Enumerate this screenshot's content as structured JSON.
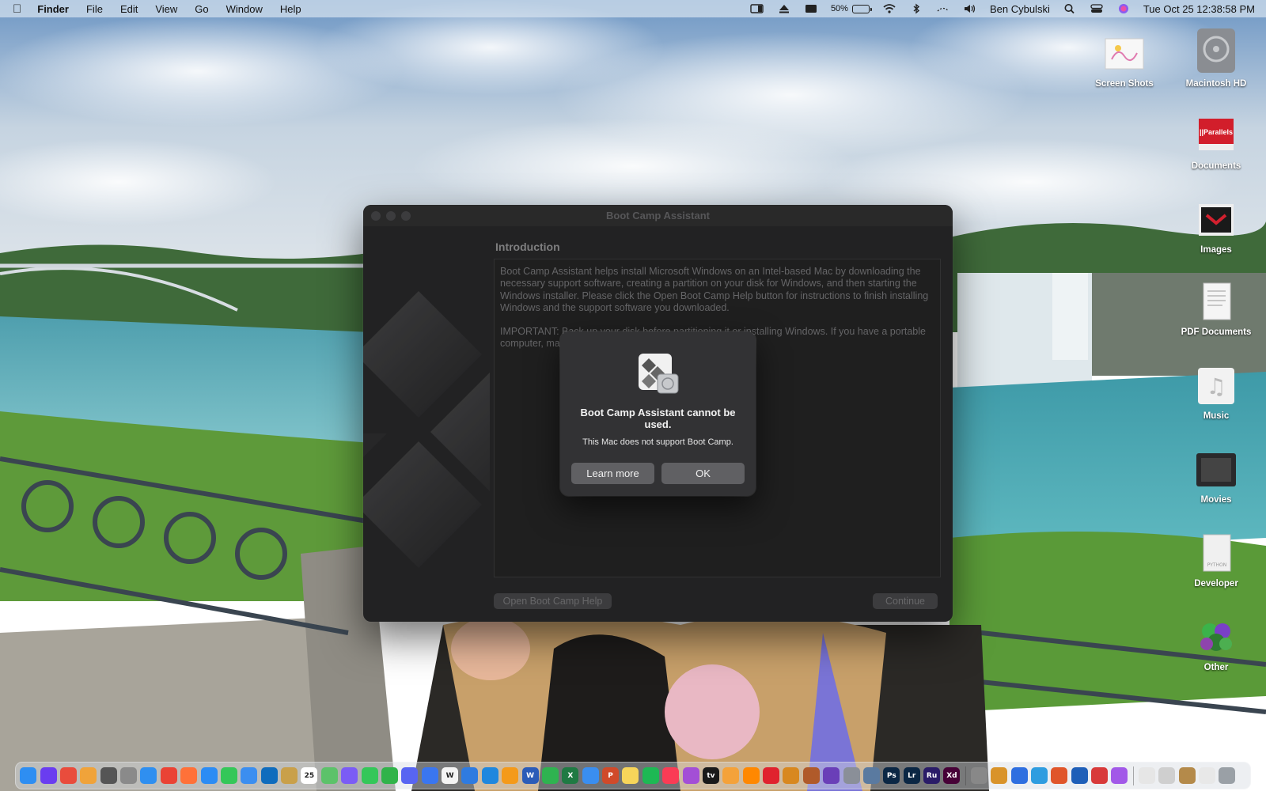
{
  "menubar": {
    "app_name": "Finder",
    "menus": [
      "File",
      "Edit",
      "View",
      "Go",
      "Window",
      "Help"
    ],
    "battery_percent": "50%",
    "battery_level": 0.5,
    "user_name": "Ben Cybulski",
    "datetime": "Tue Oct 25  12:38:58 PM"
  },
  "desktop": {
    "icons": [
      {
        "label": "Screen Shots",
        "icon": "screenshots-folder-icon"
      },
      {
        "label": "Macintosh HD",
        "icon": "hard-drive-icon"
      },
      {
        "label": "Documents",
        "icon": "documents-stack-icon"
      },
      {
        "label": "Images",
        "icon": "images-stack-icon"
      },
      {
        "label": "PDF Documents",
        "icon": "pdf-stack-icon"
      },
      {
        "label": "Music",
        "icon": "music-stack-icon"
      },
      {
        "label": "Movies",
        "icon": "movies-stack-icon"
      },
      {
        "label": "Developer",
        "icon": "developer-stack-icon"
      },
      {
        "label": "Other",
        "icon": "other-stack-icon"
      }
    ]
  },
  "window": {
    "title": "Boot Camp Assistant",
    "heading": "Introduction",
    "body_paragraph_1": "Boot Camp Assistant helps install Microsoft Windows on an Intel-based Mac by downloading the necessary support software, creating a partition on your disk for Windows, and then starting the Windows installer. Please click the Open Boot Camp Help button for instructions to finish installing Windows and the support software you downloaded.",
    "body_paragraph_2": "IMPORTANT:  Back up your disk before partitioning it or installing Windows. If you have a portable computer, make sure your power adapter is connected.",
    "help_button": "Open Boot Camp Help",
    "continue_button": "Continue"
  },
  "alert": {
    "title": "Boot Camp Assistant cannot be used.",
    "message": "This Mac does not support Boot Camp.",
    "learn_more_button": "Learn more",
    "ok_button": "OK"
  },
  "dock": {
    "items": [
      {
        "name": "finder",
        "color": "#2e8ef2",
        "glyph": ""
      },
      {
        "name": "siri",
        "color": "#6a3df0",
        "glyph": ""
      },
      {
        "name": "launchpad",
        "color": "#e94c3c",
        "glyph": ""
      },
      {
        "name": "photos",
        "color": "#f0a33a",
        "glyph": ""
      },
      {
        "name": "calculator",
        "color": "#555555",
        "glyph": ""
      },
      {
        "name": "system-preferences",
        "color": "#8a8a8a",
        "glyph": ""
      },
      {
        "name": "safari",
        "color": "#2f8ff0",
        "glyph": ""
      },
      {
        "name": "chrome",
        "color": "#ea4335",
        "glyph": ""
      },
      {
        "name": "firefox",
        "color": "#ff7139",
        "glyph": ""
      },
      {
        "name": "messenger",
        "color": "#2c8cf4",
        "glyph": ""
      },
      {
        "name": "facetime-alt",
        "color": "#34c759",
        "glyph": ""
      },
      {
        "name": "mail",
        "color": "#3b8ef0",
        "glyph": ""
      },
      {
        "name": "outlook",
        "color": "#0f6cbd",
        "glyph": ""
      },
      {
        "name": "notes-app",
        "color": "#c9a04a",
        "glyph": ""
      },
      {
        "name": "calendar",
        "color": "#ffffff",
        "glyph": "25"
      },
      {
        "name": "maps",
        "color": "#5cc26a",
        "glyph": ""
      },
      {
        "name": "messenger-2",
        "color": "#7b5cf5",
        "glyph": ""
      },
      {
        "name": "messages",
        "color": "#34c759",
        "glyph": ""
      },
      {
        "name": "facetime",
        "color": "#30b34a",
        "glyph": ""
      },
      {
        "name": "discord",
        "color": "#5865f2",
        "glyph": ""
      },
      {
        "name": "signal",
        "color": "#3a76f0",
        "glyph": ""
      },
      {
        "name": "wikipedia",
        "color": "#f4f4f4",
        "glyph": "W"
      },
      {
        "name": "screens",
        "color": "#2f7be0",
        "glyph": ""
      },
      {
        "name": "vscode",
        "color": "#1f87de",
        "glyph": ""
      },
      {
        "name": "pages",
        "color": "#f49a1a",
        "glyph": ""
      },
      {
        "name": "word",
        "color": "#2b5cb8",
        "glyph": "W"
      },
      {
        "name": "numbers",
        "color": "#2fb350",
        "glyph": ""
      },
      {
        "name": "excel",
        "color": "#1f7a43",
        "glyph": "X"
      },
      {
        "name": "keynote",
        "color": "#3a8ef0",
        "glyph": ""
      },
      {
        "name": "powerpoint",
        "color": "#d04a2a",
        "glyph": "P"
      },
      {
        "name": "notes",
        "color": "#f7d55a",
        "glyph": ""
      },
      {
        "name": "spotify",
        "color": "#1db954",
        "glyph": ""
      },
      {
        "name": "music",
        "color": "#fa3c55",
        "glyph": ""
      },
      {
        "name": "podcasts",
        "color": "#a34fd6",
        "glyph": ""
      },
      {
        "name": "apple-tv",
        "color": "#1a1a1a",
        "glyph": "tv"
      },
      {
        "name": "vlc-alt",
        "color": "#f4a23a",
        "glyph": ""
      },
      {
        "name": "vlc",
        "color": "#ff8800",
        "glyph": ""
      },
      {
        "name": "opera",
        "color": "#e0222e",
        "glyph": ""
      },
      {
        "name": "audio-app",
        "color": "#d8881f",
        "glyph": ""
      },
      {
        "name": "game-app",
        "color": "#b05a2a",
        "glyph": ""
      },
      {
        "name": "github-desktop",
        "color": "#6a3fb8",
        "glyph": ""
      },
      {
        "name": "utility",
        "color": "#8a8f98",
        "glyph": ""
      },
      {
        "name": "migration",
        "color": "#5a7aa0",
        "glyph": ""
      },
      {
        "name": "photoshop",
        "color": "#0b2744",
        "glyph": "Ps"
      },
      {
        "name": "lightroom",
        "color": "#0b2744",
        "glyph": "Lr"
      },
      {
        "name": "rush",
        "color": "#2a1c68",
        "glyph": "Ru"
      },
      {
        "name": "xd",
        "color": "#470137",
        "glyph": "Xd"
      },
      {
        "name": "creative-cloud",
        "color": "#888888",
        "glyph": ""
      },
      {
        "name": "preview",
        "color": "#d9932a",
        "glyph": ""
      },
      {
        "name": "xcode",
        "color": "#2f6fe0",
        "glyph": ""
      },
      {
        "name": "network",
        "color": "#2f9de0",
        "glyph": ""
      },
      {
        "name": "parallels",
        "color": "#e0552a",
        "glyph": ""
      },
      {
        "name": "other-app",
        "color": "#1f5fb8",
        "glyph": ""
      },
      {
        "name": "photo-booth",
        "color": "#d83a3a",
        "glyph": ""
      },
      {
        "name": "feedback",
        "color": "#a259e8",
        "glyph": ""
      },
      {
        "name": "preview-folder",
        "color": "#e6e6e6",
        "glyph": ""
      },
      {
        "name": "screenshot-app",
        "color": "#cfcfcf",
        "glyph": ""
      },
      {
        "name": "archive-folder",
        "color": "#b48a4a",
        "glyph": ""
      },
      {
        "name": "downloads-stack",
        "color": "#e8e8e8",
        "glyph": ""
      },
      {
        "name": "trash",
        "color": "#9aa0a6",
        "glyph": ""
      }
    ]
  },
  "colors": {
    "window_bg": "#2a2a2b",
    "alert_bg": "#323234",
    "alert_button": "#606063"
  }
}
